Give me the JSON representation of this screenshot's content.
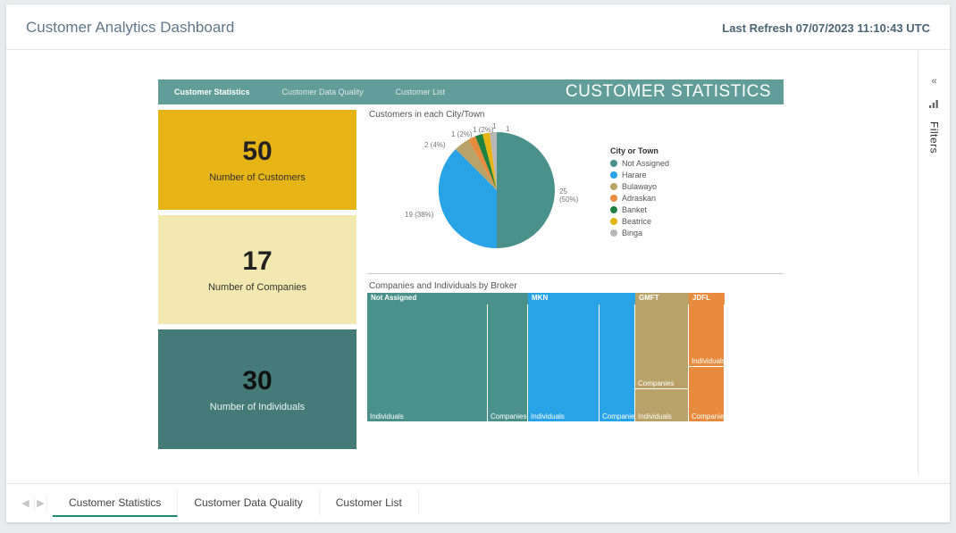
{
  "header": {
    "title": "Customer Analytics Dashboard",
    "refresh_prefix": "Last Refresh",
    "refresh_value": "07/07/2023 11:10:43 UTC"
  },
  "filters": {
    "label": "Filters"
  },
  "topnav": {
    "tab1": "Customer Statistics",
    "tab2": "Customer Data Quality",
    "tab3": "Customer List",
    "title": "CUSTOMER STATISTICS"
  },
  "kpi": {
    "customers": {
      "value": "50",
      "label": "Number of Customers"
    },
    "companies": {
      "value": "17",
      "label": "Number of Companies"
    },
    "individuals": {
      "value": "30",
      "label": "Number of Individuals"
    }
  },
  "pie_chart": {
    "title": "Customers in each City/Town",
    "legend_title": "City or Town",
    "labels": {
      "not_assigned": "25 (50%)",
      "harare": "19 (38%)",
      "bulawayo": "2 (4%)",
      "adraskan": "1 (2%)",
      "banket": "1 (2%)",
      "beatrice": "1",
      "binga": "1"
    },
    "legend": {
      "not_assigned": "Not Assigned",
      "harare": "Harare",
      "bulawayo": "Bulawayo",
      "adraskan": "Adraskan",
      "banket": "Banket",
      "beatrice": "Beatrice",
      "binga": "Binga"
    }
  },
  "treemap": {
    "title": "Companies and Individuals by Broker",
    "groups": {
      "not_assigned": "Not Assigned",
      "mkn": "MKN",
      "gmft": "GMFT",
      "jdfl": "JDFL"
    },
    "sub": {
      "individuals": "Individuals",
      "companies": "Companies"
    }
  },
  "bottom_tabs": {
    "tab1": "Customer Statistics",
    "tab2": "Customer Data Quality",
    "tab3": "Customer List"
  },
  "colors": {
    "teal": "#4a918c",
    "blue": "#29a3e8",
    "khaki": "#b8a268",
    "orange": "#e78b3f",
    "green": "#1d8240",
    "gold": "#e7b416",
    "grey": "#b8b8b8"
  },
  "chart_data": [
    {
      "type": "pie",
      "title": "Customers in each City/Town",
      "legend_title": "City or Town",
      "categories": [
        "Not Assigned",
        "Harare",
        "Bulawayo",
        "Adraskan",
        "Banket",
        "Beatrice",
        "Binga"
      ],
      "values": [
        25,
        19,
        2,
        1,
        1,
        1,
        1
      ],
      "percentages": [
        50,
        38,
        4,
        2,
        2,
        2,
        2
      ],
      "colors": [
        "#4a918c",
        "#29a3e8",
        "#b8a268",
        "#e78b3f",
        "#1d8240",
        "#e7b416",
        "#b8b8b8"
      ]
    },
    {
      "type": "treemap",
      "title": "Companies and Individuals by Broker",
      "series": [
        {
          "name": "Not Assigned",
          "color": "#4a918c",
          "children": [
            {
              "name": "Individuals",
              "value": 20
            },
            {
              "name": "Companies",
              "value": 6
            }
          ]
        },
        {
          "name": "MKN",
          "color": "#29a3e8",
          "children": [
            {
              "name": "Individuals",
              "value": 12
            },
            {
              "name": "Companies",
              "value": 6
            }
          ]
        },
        {
          "name": "GMFT",
          "color": "#b8a268",
          "children": [
            {
              "name": "Companies",
              "value": 8
            },
            {
              "name": "Individuals",
              "value": 2
            }
          ]
        },
        {
          "name": "JDFL",
          "color": "#e78b3f",
          "children": [
            {
              "name": "Individuals",
              "value": 4
            },
            {
              "name": "Companies",
              "value": 2
            }
          ]
        }
      ]
    }
  ]
}
